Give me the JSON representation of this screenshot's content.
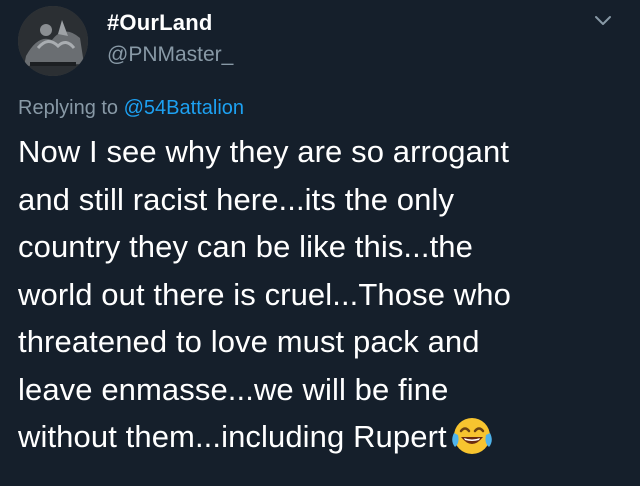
{
  "tweet": {
    "display_name": "#OurLand",
    "handle": "@PNMaster_",
    "reply_prefix": "Replying to",
    "reply_mention": "@54Battalion",
    "body_lines": [
      "Now I see why they are so arrogant",
      "and still racist here...its the only",
      "country they can be like this...the",
      "world out there is cruel...Those who",
      "threatened to love must pack and",
      "leave enmasse...we will be fine",
      "without them...including Rupert"
    ],
    "emoji": "face-with-tears-of-joy-icon"
  },
  "colors": {
    "background": "#151f2b",
    "text": "#ffffff",
    "secondary_text": "#8899a6",
    "link": "#1da1f2"
  }
}
